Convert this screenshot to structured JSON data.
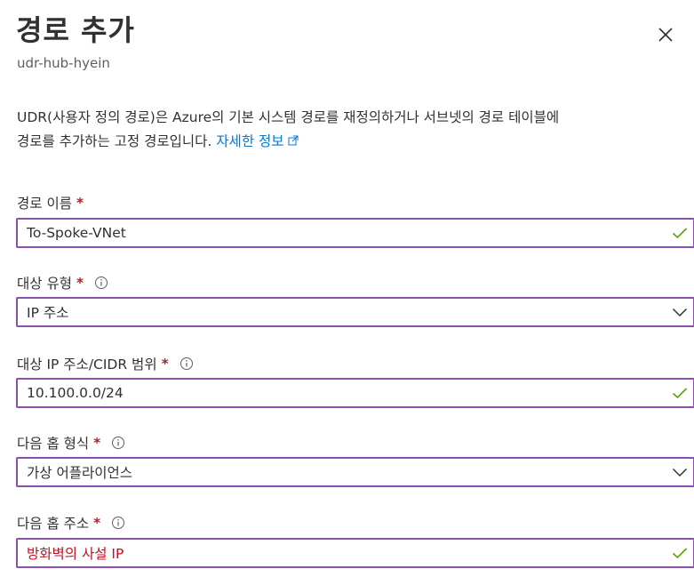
{
  "header": {
    "title": "경로 추가",
    "subtitle": "udr-hub-hyein",
    "close_icon": "close-icon"
  },
  "description": {
    "line1": "UDR(사용자 정의 경로)은 Azure의 기본 시스템 경로를 재정의하거나 서브넷의 경로 테이블에",
    "line2": "경로를 추가하는 고정 경로입니다.",
    "link": "자세한 정보"
  },
  "form": {
    "route_name": {
      "label": "경로 이름",
      "required": "*",
      "value": "To-Spoke-VNet"
    },
    "destination_type": {
      "label": "대상 유형",
      "required": "*",
      "value": "IP 주소"
    },
    "destination_cidr": {
      "label": "대상 IP 주소/CIDR 범위",
      "required": "*",
      "value": "10.100.0.0/24"
    },
    "next_hop_type": {
      "label": "다음 홉 형식",
      "required": "*",
      "value": "가상 어플라이언스"
    },
    "next_hop_address": {
      "label": "다음 홉 주소",
      "required": "*",
      "value": "방화벽의 사설 IP"
    }
  },
  "colors": {
    "border_focus": "#8a4fb0",
    "required": "#a4262c",
    "link": "#0078d4",
    "valid_check": "#57a300",
    "annotation_text": "#c50f1f"
  }
}
